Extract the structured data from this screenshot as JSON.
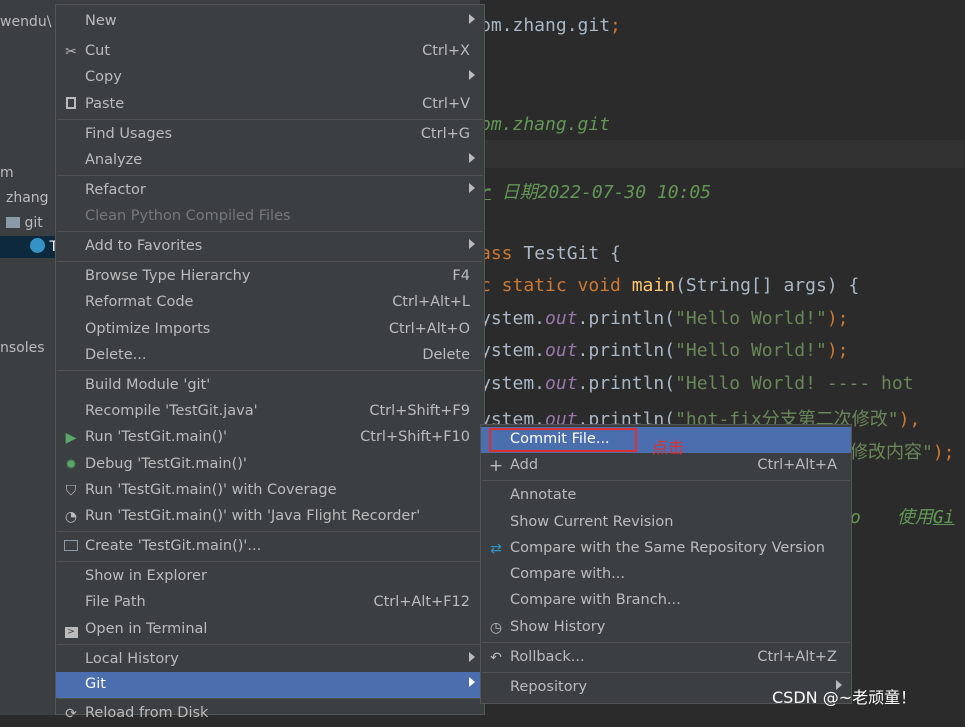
{
  "project": {
    "items": [
      "wendu\\",
      "m",
      "zhang",
      "git",
      "T",
      "nsoles"
    ]
  },
  "editor": {
    "lines": {
      "l1a": "om.zhang.git",
      "l1b": ";",
      "l2": "om.zhang.git",
      "l3a": "r",
      "l3b": " 日期2022-07-30 10:05",
      "l4a": "ass ",
      "l4b": "TestGit {",
      "l5a": "c static void ",
      "l5b": "main",
      "l5c": "(String[] args) {",
      "l6a": "ystem.",
      "l6b": "out",
      "l6c": ".println(",
      "l6d": "\"Hello World!\"",
      "l6e": ");",
      "l7d": "\"Hello World!\"",
      "l8d": "\"Hello World! ---- hot",
      "l9d": "\"hot-fix分支第二次修改\"",
      "l9e": "),",
      "l10a": "修改内容\"",
      "l10b": ");",
      "l11a": "o",
      "l11b": "使用",
      "l11c": "Gi"
    }
  },
  "main_menu": {
    "items": {
      "new": {
        "label": "New"
      },
      "cut": {
        "label": "Cut",
        "shortcut": "Ctrl+X"
      },
      "copy": {
        "label": "Copy"
      },
      "paste": {
        "label": "Paste",
        "shortcut": "Ctrl+V"
      },
      "find_usages": {
        "label": "Find Usages",
        "shortcut": "Ctrl+G"
      },
      "analyze": {
        "label": "Analyze"
      },
      "refactor": {
        "label": "Refactor"
      },
      "clean_python": {
        "label": "Clean Python Compiled Files"
      },
      "add_favorites": {
        "label": "Add to Favorites"
      },
      "browse_type": {
        "label": "Browse Type Hierarchy",
        "shortcut": "F4"
      },
      "reformat": {
        "label": "Reformat Code",
        "shortcut": "Ctrl+Alt+L"
      },
      "optimize": {
        "label": "Optimize Imports",
        "shortcut": "Ctrl+Alt+O"
      },
      "delete": {
        "label": "Delete...",
        "shortcut": "Delete"
      },
      "build_module": {
        "label": "Build Module 'git'"
      },
      "recompile": {
        "label": "Recompile 'TestGit.java'",
        "shortcut": "Ctrl+Shift+F9"
      },
      "run": {
        "label": "Run 'TestGit.main()'",
        "shortcut": "Ctrl+Shift+F10"
      },
      "debug": {
        "label": "Debug 'TestGit.main()'"
      },
      "coverage": {
        "label": "Run 'TestGit.main()' with Coverage"
      },
      "jfr": {
        "label": "Run 'TestGit.main()' with 'Java Flight Recorder'"
      },
      "create": {
        "label": "Create 'TestGit.main()'..."
      },
      "explorer": {
        "label": "Show in Explorer"
      },
      "file_path": {
        "label": "File Path",
        "shortcut": "Ctrl+Alt+F12"
      },
      "terminal": {
        "label": "Open in Terminal"
      },
      "local_history": {
        "label": "Local History"
      },
      "git": {
        "label": "Git"
      },
      "reload": {
        "label": "Reload from Disk"
      }
    }
  },
  "git_menu": {
    "items": {
      "commit": {
        "label": "Commit File..."
      },
      "add": {
        "label": "Add",
        "shortcut": "Ctrl+Alt+A"
      },
      "annotate": {
        "label": "Annotate"
      },
      "show_revision": {
        "label": "Show Current Revision"
      },
      "compare_repo": {
        "label": "Compare with the Same Repository Version"
      },
      "compare_with": {
        "label": "Compare with..."
      },
      "compare_branch": {
        "label": "Compare with Branch..."
      },
      "show_history": {
        "label": "Show History"
      },
      "rollback": {
        "label": "Rollback...",
        "shortcut": "Ctrl+Alt+Z"
      },
      "repository": {
        "label": "Repository"
      }
    }
  },
  "annotation": {
    "note": "点击"
  },
  "watermark": "CSDN @~老顽童！",
  "colors": {
    "menu_bg": "#3c3f41",
    "highlight": "#4b6eaf",
    "annotation": "#e03030"
  }
}
